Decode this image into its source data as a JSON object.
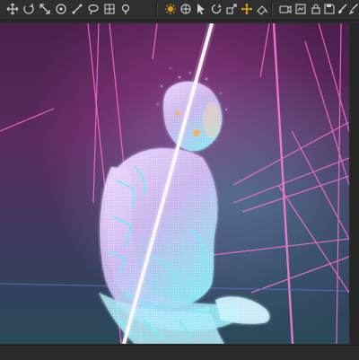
{
  "toolbar": {
    "left_tools": [
      {
        "name": "move-scene-icon"
      },
      {
        "name": "rotate-scene-icon"
      },
      {
        "name": "scale-scene-icon"
      },
      {
        "name": "camera-orbit-icon"
      },
      {
        "name": "node-pick-icon"
      },
      {
        "name": "lasso-select-icon"
      },
      {
        "name": "grid-snap-icon"
      },
      {
        "name": "light-bulb-icon"
      }
    ],
    "right_tools": [
      {
        "name": "sun-light-icon",
        "color": "#e0a21c"
      },
      {
        "name": "universal-manipulator-icon"
      },
      {
        "name": "select-arrow-icon"
      },
      {
        "name": "rotate-tool-icon"
      },
      {
        "name": "scale-tool-icon"
      },
      {
        "name": "translate-tool-icon",
        "color": "#e0a21c"
      },
      {
        "name": "paint-tool-icon"
      },
      {
        "name": "camera-tool-icon"
      },
      {
        "name": "render-settings-icon"
      },
      {
        "name": "lock-icon"
      },
      {
        "name": "save-icon"
      },
      {
        "name": "link-icon"
      },
      {
        "name": "brush-icon"
      },
      {
        "name": "color-picker-icon"
      }
    ]
  },
  "viewport": {
    "scene": "pixel-cloud-figure-render",
    "colors": {
      "bg_top": "#4a1f4c",
      "bg_bottom": "#2a4a5a",
      "laser_pink": "#ff5fd0",
      "figure_cyan": "#7fe7f5",
      "figure_lavender": "#d9c8f2"
    }
  }
}
